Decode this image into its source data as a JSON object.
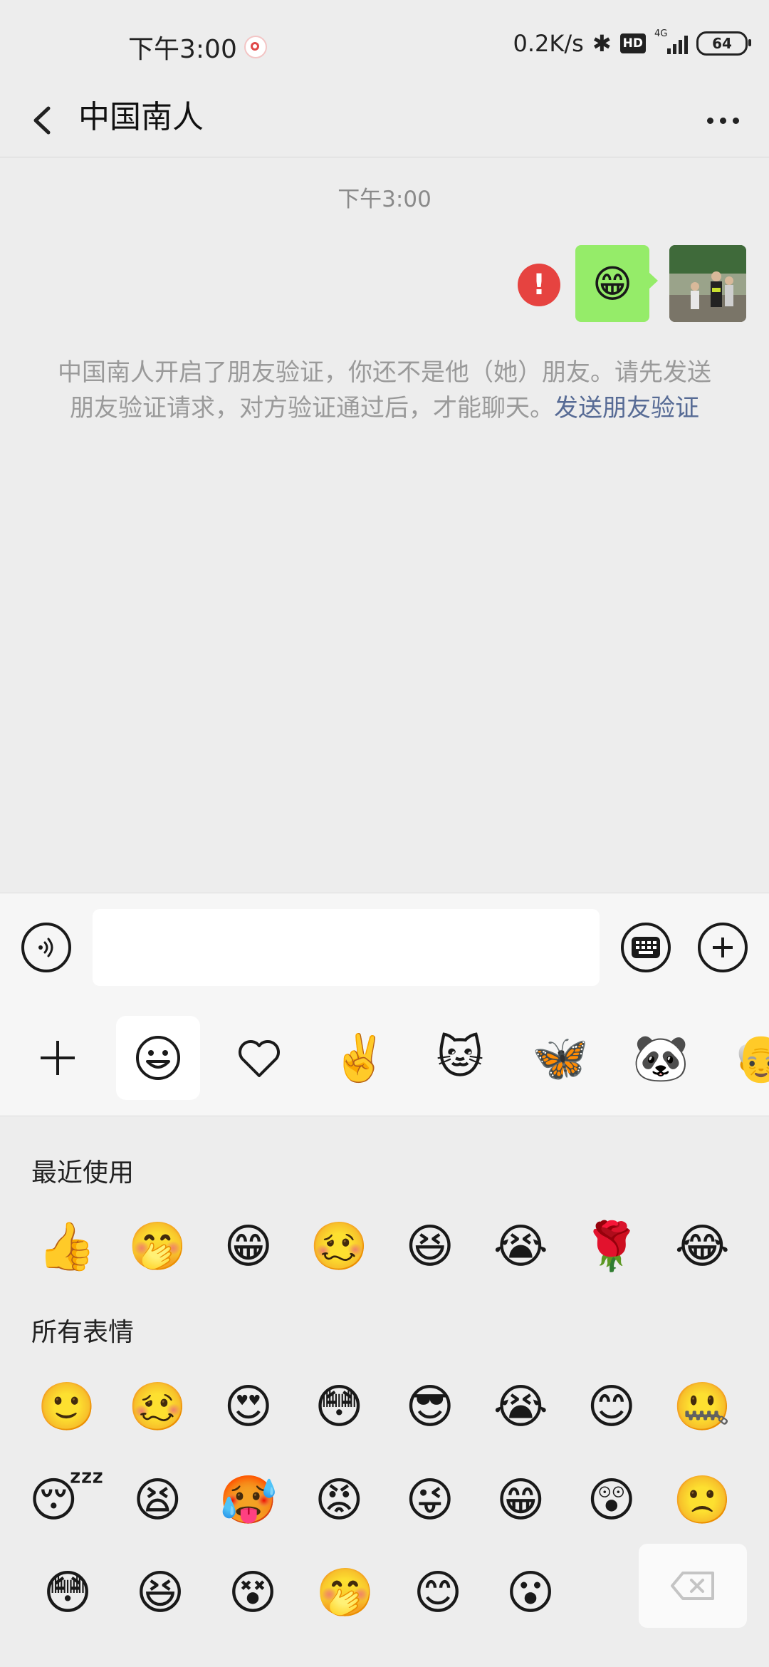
{
  "status_bar": {
    "time": "下午3:00",
    "net_speed": "0.2K/s",
    "hd": "HD",
    "network": "4G",
    "battery": "64"
  },
  "header": {
    "title": "中国南人"
  },
  "chat": {
    "timestamp": "下午3:00",
    "sent_message_emoji": "😁",
    "error_mark": "!",
    "notice_text": "中国南人开启了朋友验证，你还不是他（她）朋友。请先发送朋友验证请求，对方验证通过后，才能聊天。",
    "notice_link": "发送朋友验证"
  },
  "input": {
    "value": "",
    "placeholder": ""
  },
  "sticker_tabs": [
    "add",
    "emoji",
    "favorites",
    "gesture",
    "cat",
    "butterfly",
    "panda",
    "person"
  ],
  "emoji_panel": {
    "recent_label": "最近使用",
    "all_label": "所有表情",
    "recent": [
      "👍",
      "🤭",
      "😁",
      "🥴",
      "😆",
      "😭",
      "🌹",
      "😂"
    ],
    "all_row1": [
      "🙂",
      "🥴",
      "😍",
      "😳",
      "😎",
      "😭",
      "😊",
      "🤐"
    ],
    "all_row2": [
      "😴",
      "😫",
      "🥵",
      "😡",
      "😜",
      "😁",
      "😲",
      "🙁"
    ],
    "all_row3": [
      "😳",
      "😆",
      "😵",
      "🤭",
      "😊",
      "😮"
    ]
  }
}
